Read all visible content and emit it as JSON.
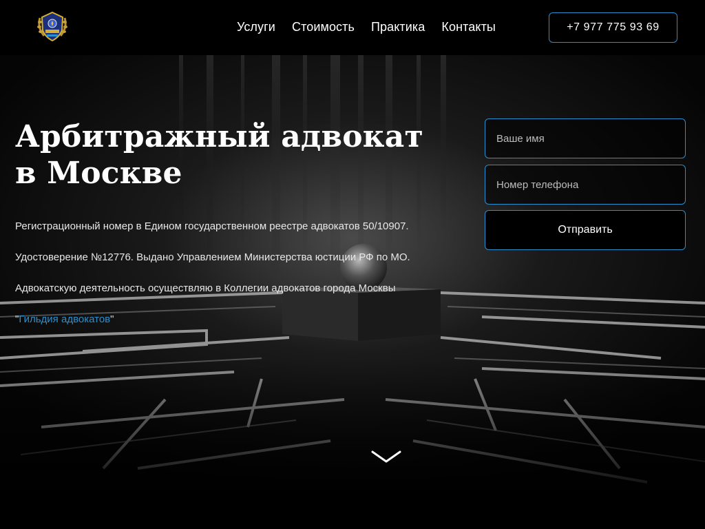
{
  "header": {
    "logo_icon": "law-guild-emblem-icon",
    "nav": [
      {
        "label": "Услуги"
      },
      {
        "label": "Стоимость"
      },
      {
        "label": "Практика"
      },
      {
        "label": "Контакты"
      }
    ],
    "phone": "+7 977 775 93 69"
  },
  "hero": {
    "title": "Арбитражный адвокат\nв Москве",
    "info_lines": [
      "Регистрационный номер в Едином государственном реестре адвокатов 50/10907.",
      "Удостоверение №12776. Выдано Управлением Министерства юстиции РФ по МО.",
      "Адвокатскую деятельность осуществляю в Коллегии адвокатов города Москвы"
    ],
    "guild_link_prefix": "\"",
    "guild_link": "Гильдия адвокатов",
    "guild_link_suffix": "\"",
    "scroll_icon": "chevron-down-icon"
  },
  "form": {
    "name_placeholder": "Ваше имя",
    "phone_placeholder": "Номер телефона",
    "submit_label": "Отправить"
  },
  "colors": {
    "accent": "#2a8fd0",
    "background": "#000000",
    "text": "#ffffff"
  }
}
